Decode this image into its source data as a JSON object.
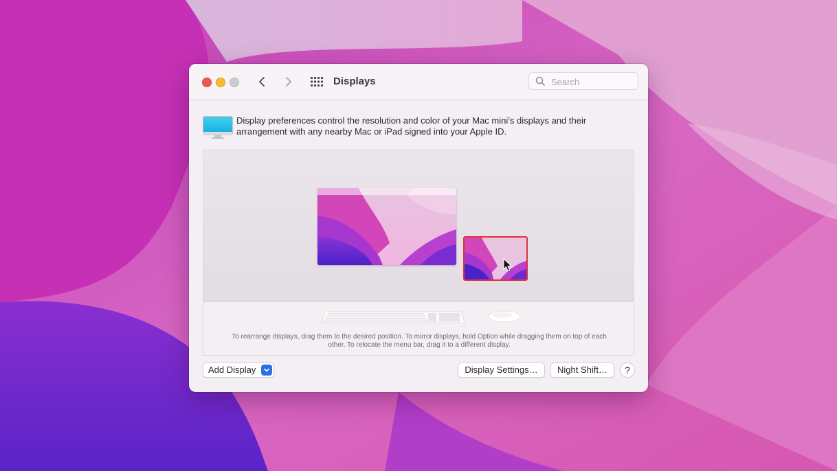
{
  "window": {
    "title": "Displays",
    "search_placeholder": "Search"
  },
  "intro": {
    "text": "Display preferences control the resolution and color of your Mac mini’s displays and their arrangement with any nearby Mac or iPad signed into your Apple ID."
  },
  "arrangement": {
    "hint": "To rearrange displays, drag them to the desired position. To mirror displays, hold Option while dragging them on top of each other. To relocate the menu bar, drag it to a different display."
  },
  "footer": {
    "add_display_label": "Add Display",
    "display_settings_label": "Display Settings…",
    "night_shift_label": "Night Shift…",
    "help_label": "?"
  },
  "icons": {
    "back": "chevron-left-icon",
    "forward": "chevron-right-icon",
    "grid": "grid-icon",
    "search": "search-icon",
    "monitor": "monitor-icon",
    "keyboard": "keyboard-icon",
    "mouse": "mouse-icon",
    "cursor": "cursor-icon"
  },
  "colors": {
    "close": "#ee5a52",
    "minimize": "#f5bd2f",
    "zoom": "#cfcacf",
    "accent": "#2c6fe6",
    "selection": "#e0313b"
  }
}
